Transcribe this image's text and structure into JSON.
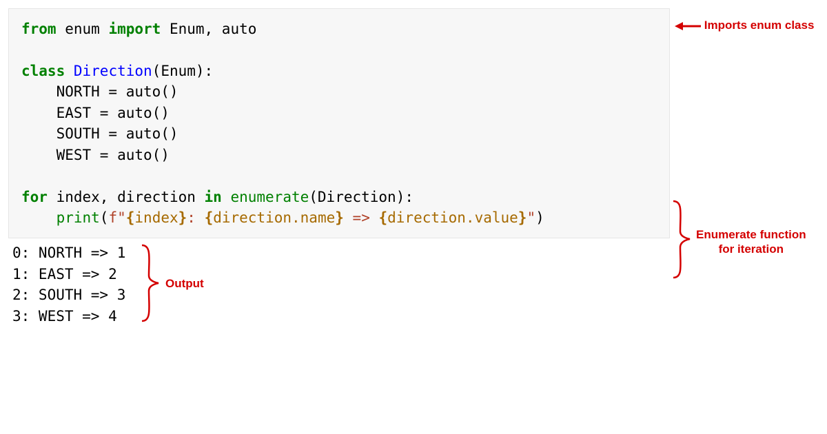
{
  "code": {
    "line1": {
      "from": "from",
      "enum_mod": " enum ",
      "import": "import",
      "rest": " Enum, auto"
    },
    "line3": {
      "class": "class",
      "sp": " ",
      "name": "Direction",
      "after": "(Enum):"
    },
    "line4": "    NORTH = auto()",
    "line5": "    EAST = auto()",
    "line6": "    SOUTH = auto()",
    "line7": "    WEST = auto()",
    "line9": {
      "for": "for",
      "mid": " index, direction ",
      "in": "in",
      "sp": " ",
      "enumerate": "enumerate",
      "after": "(Direction):"
    },
    "line10": {
      "indent": "    ",
      "print": "print",
      "open": "(",
      "fs_start": "f\"",
      "i_open1": "{",
      "i_body1": "index",
      "i_close1": "}",
      "s_mid1": ": ",
      "i_open2": "{",
      "i_body2": "direction.name",
      "i_close2": "}",
      "s_mid2": " => ",
      "i_open3": "{",
      "i_body3": "direction.value",
      "i_close3": "}",
      "fs_end": "\"",
      "close": ")"
    }
  },
  "output": {
    "l1": "0: NORTH => 1",
    "l2": "1: EAST => 2",
    "l3": "2: SOUTH => 3",
    "l4": "3: WEST => 4"
  },
  "annotations": {
    "imports": "Imports enum class",
    "enumerate": "Enumerate function\nfor iteration",
    "output": "Output"
  }
}
